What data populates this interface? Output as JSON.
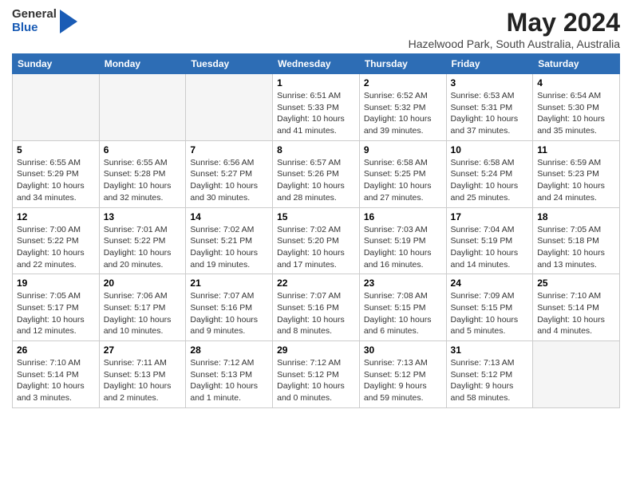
{
  "header": {
    "logo_general": "General",
    "logo_blue": "Blue",
    "title": "May 2024",
    "subtitle": "Hazelwood Park, South Australia, Australia"
  },
  "columns": [
    "Sunday",
    "Monday",
    "Tuesday",
    "Wednesday",
    "Thursday",
    "Friday",
    "Saturday"
  ],
  "weeks": [
    [
      {
        "day": "",
        "info": ""
      },
      {
        "day": "",
        "info": ""
      },
      {
        "day": "",
        "info": ""
      },
      {
        "day": "1",
        "info": "Sunrise: 6:51 AM\nSunset: 5:33 PM\nDaylight: 10 hours\nand 41 minutes."
      },
      {
        "day": "2",
        "info": "Sunrise: 6:52 AM\nSunset: 5:32 PM\nDaylight: 10 hours\nand 39 minutes."
      },
      {
        "day": "3",
        "info": "Sunrise: 6:53 AM\nSunset: 5:31 PM\nDaylight: 10 hours\nand 37 minutes."
      },
      {
        "day": "4",
        "info": "Sunrise: 6:54 AM\nSunset: 5:30 PM\nDaylight: 10 hours\nand 35 minutes."
      }
    ],
    [
      {
        "day": "5",
        "info": "Sunrise: 6:55 AM\nSunset: 5:29 PM\nDaylight: 10 hours\nand 34 minutes."
      },
      {
        "day": "6",
        "info": "Sunrise: 6:55 AM\nSunset: 5:28 PM\nDaylight: 10 hours\nand 32 minutes."
      },
      {
        "day": "7",
        "info": "Sunrise: 6:56 AM\nSunset: 5:27 PM\nDaylight: 10 hours\nand 30 minutes."
      },
      {
        "day": "8",
        "info": "Sunrise: 6:57 AM\nSunset: 5:26 PM\nDaylight: 10 hours\nand 28 minutes."
      },
      {
        "day": "9",
        "info": "Sunrise: 6:58 AM\nSunset: 5:25 PM\nDaylight: 10 hours\nand 27 minutes."
      },
      {
        "day": "10",
        "info": "Sunrise: 6:58 AM\nSunset: 5:24 PM\nDaylight: 10 hours\nand 25 minutes."
      },
      {
        "day": "11",
        "info": "Sunrise: 6:59 AM\nSunset: 5:23 PM\nDaylight: 10 hours\nand 24 minutes."
      }
    ],
    [
      {
        "day": "12",
        "info": "Sunrise: 7:00 AM\nSunset: 5:22 PM\nDaylight: 10 hours\nand 22 minutes."
      },
      {
        "day": "13",
        "info": "Sunrise: 7:01 AM\nSunset: 5:22 PM\nDaylight: 10 hours\nand 20 minutes."
      },
      {
        "day": "14",
        "info": "Sunrise: 7:02 AM\nSunset: 5:21 PM\nDaylight: 10 hours\nand 19 minutes."
      },
      {
        "day": "15",
        "info": "Sunrise: 7:02 AM\nSunset: 5:20 PM\nDaylight: 10 hours\nand 17 minutes."
      },
      {
        "day": "16",
        "info": "Sunrise: 7:03 AM\nSunset: 5:19 PM\nDaylight: 10 hours\nand 16 minutes."
      },
      {
        "day": "17",
        "info": "Sunrise: 7:04 AM\nSunset: 5:19 PM\nDaylight: 10 hours\nand 14 minutes."
      },
      {
        "day": "18",
        "info": "Sunrise: 7:05 AM\nSunset: 5:18 PM\nDaylight: 10 hours\nand 13 minutes."
      }
    ],
    [
      {
        "day": "19",
        "info": "Sunrise: 7:05 AM\nSunset: 5:17 PM\nDaylight: 10 hours\nand 12 minutes."
      },
      {
        "day": "20",
        "info": "Sunrise: 7:06 AM\nSunset: 5:17 PM\nDaylight: 10 hours\nand 10 minutes."
      },
      {
        "day": "21",
        "info": "Sunrise: 7:07 AM\nSunset: 5:16 PM\nDaylight: 10 hours\nand 9 minutes."
      },
      {
        "day": "22",
        "info": "Sunrise: 7:07 AM\nSunset: 5:16 PM\nDaylight: 10 hours\nand 8 minutes."
      },
      {
        "day": "23",
        "info": "Sunrise: 7:08 AM\nSunset: 5:15 PM\nDaylight: 10 hours\nand 6 minutes."
      },
      {
        "day": "24",
        "info": "Sunrise: 7:09 AM\nSunset: 5:15 PM\nDaylight: 10 hours\nand 5 minutes."
      },
      {
        "day": "25",
        "info": "Sunrise: 7:10 AM\nSunset: 5:14 PM\nDaylight: 10 hours\nand 4 minutes."
      }
    ],
    [
      {
        "day": "26",
        "info": "Sunrise: 7:10 AM\nSunset: 5:14 PM\nDaylight: 10 hours\nand 3 minutes."
      },
      {
        "day": "27",
        "info": "Sunrise: 7:11 AM\nSunset: 5:13 PM\nDaylight: 10 hours\nand 2 minutes."
      },
      {
        "day": "28",
        "info": "Sunrise: 7:12 AM\nSunset: 5:13 PM\nDaylight: 10 hours\nand 1 minute."
      },
      {
        "day": "29",
        "info": "Sunrise: 7:12 AM\nSunset: 5:12 PM\nDaylight: 10 hours\nand 0 minutes."
      },
      {
        "day": "30",
        "info": "Sunrise: 7:13 AM\nSunset: 5:12 PM\nDaylight: 9 hours\nand 59 minutes."
      },
      {
        "day": "31",
        "info": "Sunrise: 7:13 AM\nSunset: 5:12 PM\nDaylight: 9 hours\nand 58 minutes."
      },
      {
        "day": "",
        "info": ""
      }
    ]
  ]
}
